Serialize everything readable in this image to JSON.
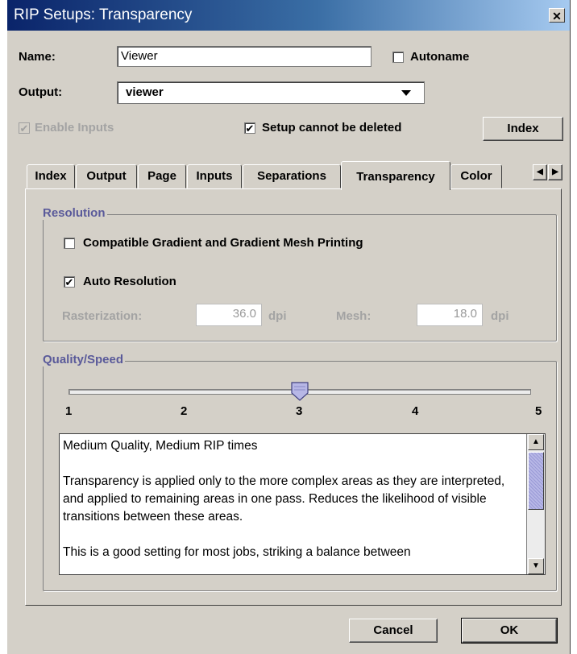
{
  "window": {
    "title": "RIP Setups: Transparency",
    "close_glyph": "✕"
  },
  "name_row": {
    "label": "Name:",
    "value": "Viewer",
    "autoname_label": "Autoname",
    "autoname_checked": false
  },
  "output_row": {
    "label": "Output:",
    "selected": "viewer"
  },
  "options_row": {
    "enable_inputs_label": "Enable Inputs",
    "enable_inputs_checked": true,
    "enable_inputs_disabled": true,
    "setup_cannot_be_deleted_label": "Setup cannot be deleted",
    "setup_cannot_be_deleted_checked": true,
    "index_button": "Index"
  },
  "tabs": [
    {
      "label": "Index"
    },
    {
      "label": "Output"
    },
    {
      "label": "Page"
    },
    {
      "label": "Inputs"
    },
    {
      "label": "Separations"
    },
    {
      "label": "Transparency",
      "active": true
    },
    {
      "label": "Color"
    }
  ],
  "resolution": {
    "legend": "Resolution",
    "compatible_label": "Compatible Gradient and Gradient Mesh Printing",
    "compatible_checked": false,
    "auto_label": "Auto Resolution",
    "auto_checked": true,
    "rasterization_label": "Rasterization:",
    "rasterization_value": "36.0",
    "rasterization_unit": "dpi",
    "mesh_label": "Mesh:",
    "mesh_value": "18.0",
    "mesh_unit": "dpi"
  },
  "quality": {
    "legend": "Quality/Speed",
    "ticks": [
      "1",
      "2",
      "3",
      "4",
      "5"
    ],
    "slider_value": 3,
    "description": [
      "Medium Quality, Medium RIP times",
      "",
      "Transparency is applied only to the more complex areas as they are interpreted, and applied to remaining areas in one pass. Reduces the likelihood of visible transitions between these areas.",
      "",
      "This is a good setting for most jobs, striking a balance between"
    ]
  },
  "footer": {
    "cancel": "Cancel",
    "ok": "OK"
  },
  "colors": {
    "titlebar_start": "#0a246a",
    "titlebar_end": "#a6caf0",
    "dialog_bg": "#d4d0c8",
    "legend_text": "#5a5a9a",
    "slider_thumb": "#b7b7e6"
  },
  "icons": {
    "close": "close-icon",
    "dropdown": "chevron-down-icon",
    "scroll_up": "arrow-up-icon",
    "scroll_down": "arrow-down-icon",
    "tab_left": "arrow-left-icon",
    "tab_right": "arrow-right-icon"
  }
}
